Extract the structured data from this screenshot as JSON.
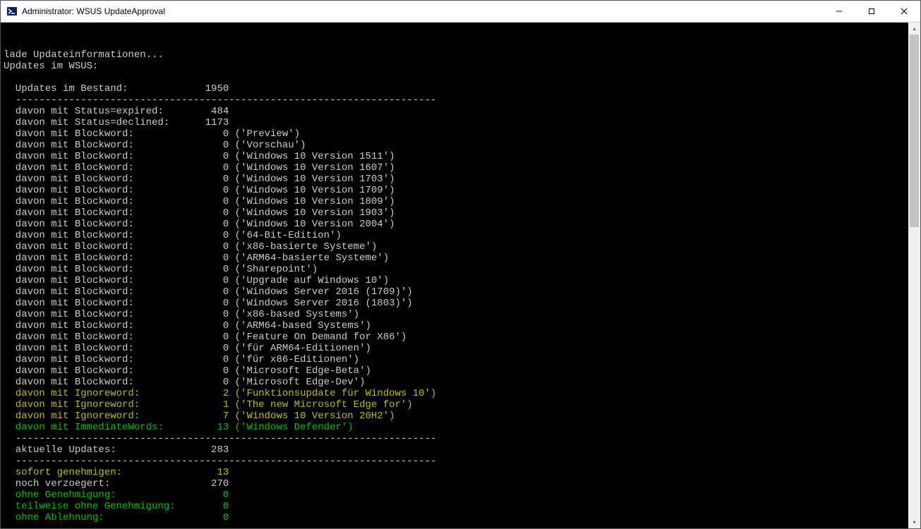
{
  "window": {
    "title": "Administrator: WSUS UpdateApproval"
  },
  "hdr": {
    "loading": "lade Updateinformationen...",
    "scope": "Updates im WSUS:"
  },
  "sep": "  -----------------------------------------------------------------------",
  "stats": {
    "inventory": {
      "label": "  Updates im Bestand:",
      "val": "1950"
    },
    "expired": {
      "label": "  davon mit Status=expired:",
      "val": "484"
    },
    "declined": {
      "label": "  davon mit Status=declined:",
      "val": "1173"
    }
  },
  "blockwords": [
    {
      "val": "0",
      "word": "'Preview'"
    },
    {
      "val": "0",
      "word": "'Vorschau'"
    },
    {
      "val": "0",
      "word": "'Windows 10 Version 1511'"
    },
    {
      "val": "0",
      "word": "'Windows 10 Version 1607'"
    },
    {
      "val": "0",
      "word": "'Windows 10 Version 1703'"
    },
    {
      "val": "0",
      "word": "'Windows 10 Version 1709'"
    },
    {
      "val": "0",
      "word": "'Windows 10 Version 1809'"
    },
    {
      "val": "0",
      "word": "'Windows 10 Version 1903'"
    },
    {
      "val": "0",
      "word": "'Windows 10 Version 2004'"
    },
    {
      "val": "0",
      "word": "'64-Bit-Edition'"
    },
    {
      "val": "0",
      "word": "'x86-basierte Systeme'"
    },
    {
      "val": "0",
      "word": "'ARM64-basierte Systeme'"
    },
    {
      "val": "0",
      "word": "'Sharepoint'"
    },
    {
      "val": "0",
      "word": "'Upgrade auf Windows 10'"
    },
    {
      "val": "0",
      "word": "'Windows Server 2016 (1709)'"
    },
    {
      "val": "0",
      "word": "'Windows Server 2016 (1803)'"
    },
    {
      "val": "0",
      "word": "'x86-based Systems'"
    },
    {
      "val": "0",
      "word": "'ARM64-based Systems'"
    },
    {
      "val": "0",
      "word": "'Feature On Demand for X86'"
    },
    {
      "val": "0",
      "word": "'für ARM64-Editionen'"
    },
    {
      "val": "0",
      "word": "'für x86-Editionen'"
    },
    {
      "val": "0",
      "word": "'Microsoft Edge-Beta'"
    },
    {
      "val": "0",
      "word": "'Microsoft Edge-Dev'"
    }
  ],
  "block_label": "  davon mit Blockword:",
  "ignorewords": [
    {
      "val": "2",
      "word": "'Funktionsupdate für Windows 10'"
    },
    {
      "val": "1",
      "word": "'The new Microsoft Edge for'"
    },
    {
      "val": "7",
      "word": "'Windows 10 Version 20H2'"
    }
  ],
  "ignore_label": "  davon mit Ignoreword:",
  "immediate": {
    "label": "  davon mit ImmediateWords:",
    "val": "13",
    "word": "'Windows Defender'"
  },
  "current": {
    "label": "  aktuelle Updates:",
    "val": "283"
  },
  "footer": {
    "approve": {
      "label": "  sofort genehmigen:",
      "val": "13"
    },
    "delayed": {
      "label": "  noch verzoegert:",
      "val": "270"
    },
    "noappr": {
      "label": "  ohne Genehmigung:",
      "val": "0"
    },
    "partial": {
      "label": "  teilweise ohne Genehmigung:",
      "val": "0"
    },
    "noreject": {
      "label": "  ohne Ablehnung:",
      "val": "0"
    }
  }
}
